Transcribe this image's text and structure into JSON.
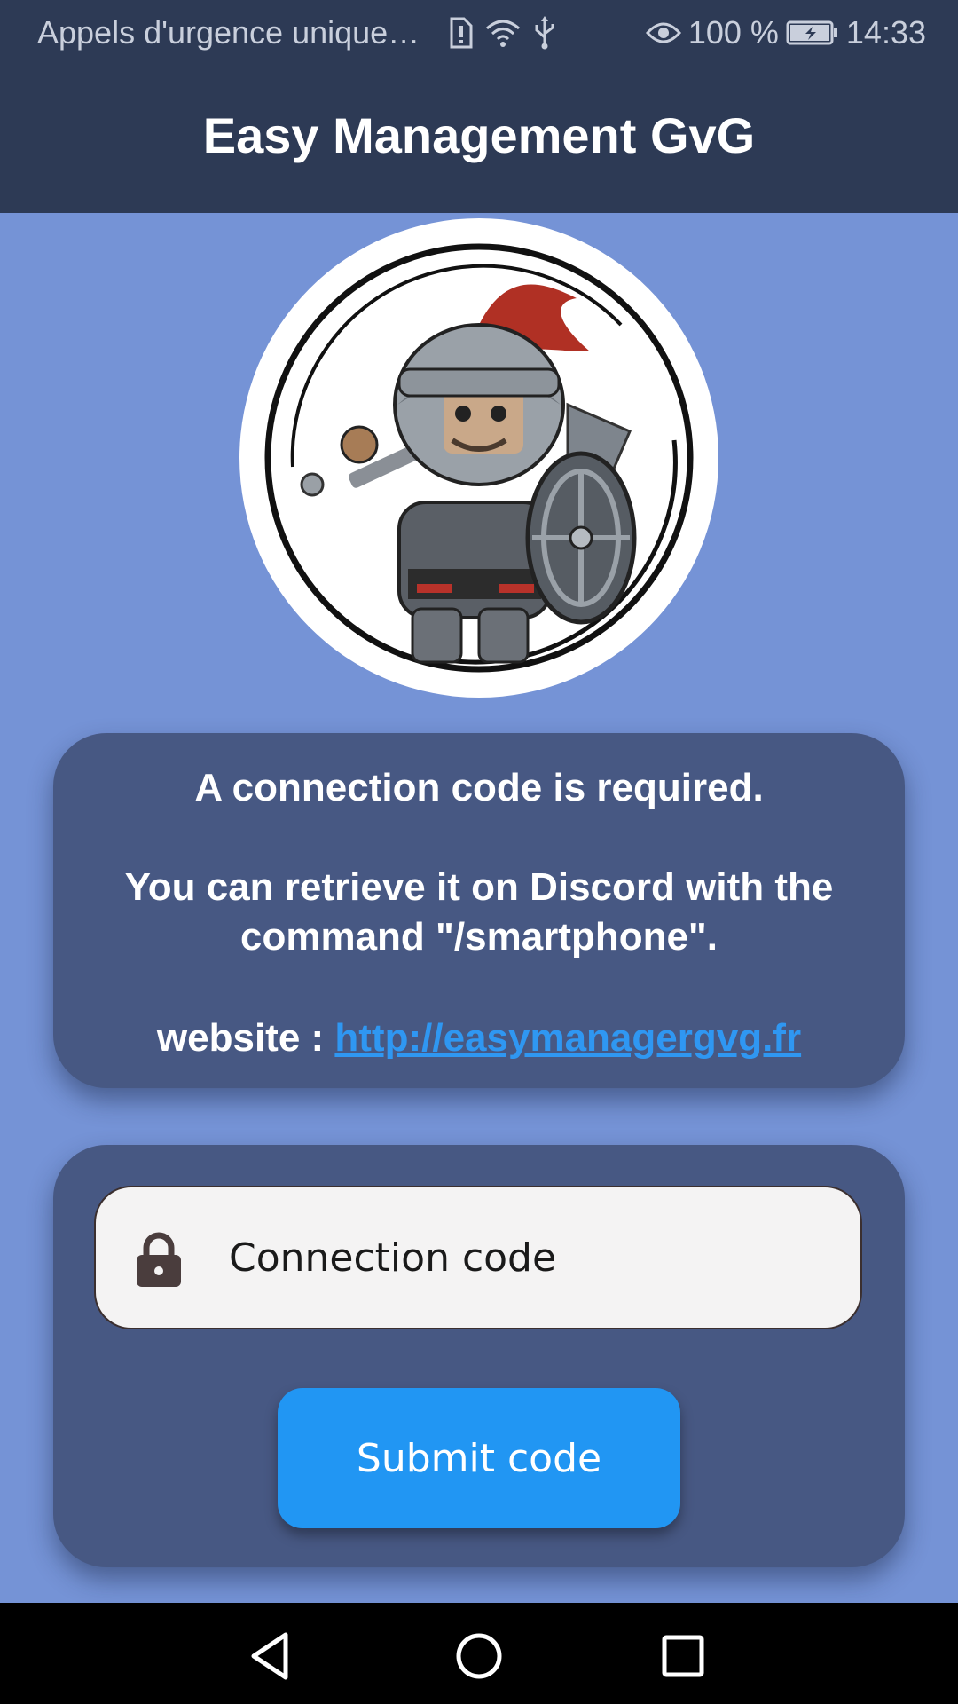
{
  "status_bar": {
    "carrier_text": "Appels d'urgence unique…",
    "battery_percent": "100 %",
    "time": "14:33",
    "icons": [
      "sim-alert-icon",
      "wifi-icon",
      "usb-icon",
      "eye-icon",
      "battery-charging-icon"
    ]
  },
  "app_bar": {
    "title": "Easy Management GvG"
  },
  "avatar": {
    "icon": "knight-warrior-logo"
  },
  "info_card": {
    "line1": "A connection code is required.",
    "line2": "You can retrieve it on Discord with the",
    "line3": "command \"/smartphone\".",
    "website_label": "website : ",
    "website_url": "http://easymanagergvg.fr"
  },
  "form": {
    "code_placeholder": "Connection code",
    "code_value": "",
    "submit_label": "Submit code"
  },
  "nav_bar": {
    "icons": [
      "back-triangle-icon",
      "home-circle-icon",
      "recents-square-icon"
    ]
  },
  "colors": {
    "background": "#7593d6",
    "bar": "#2d3a55",
    "card": "#475883",
    "accent": "#2196f3",
    "link": "#2f97f2"
  }
}
